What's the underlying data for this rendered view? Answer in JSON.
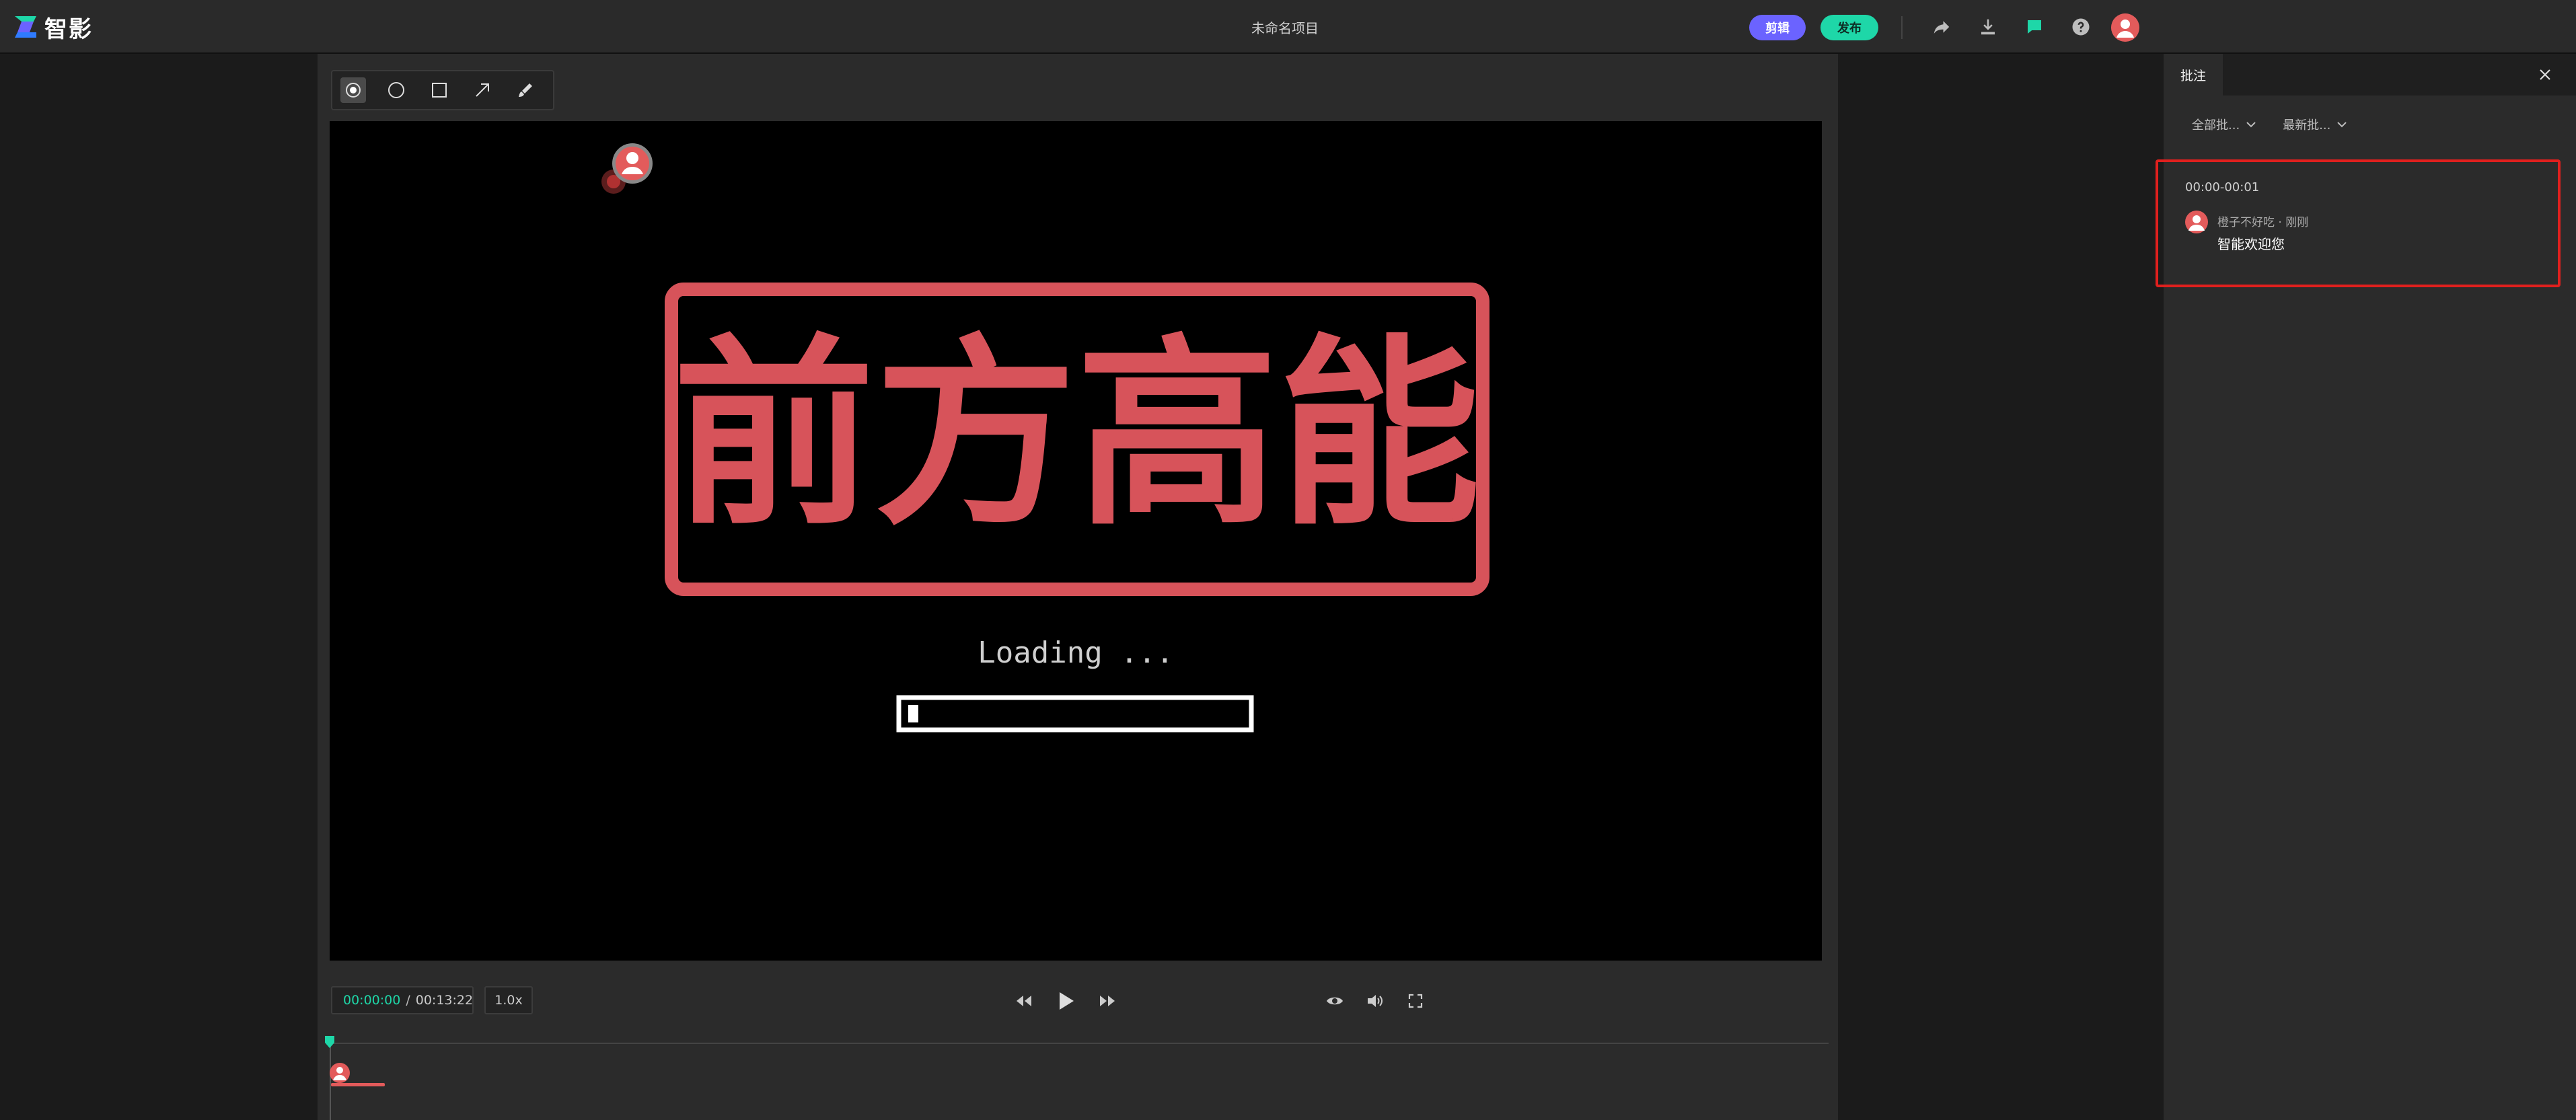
{
  "app": {
    "logo_text": "智影",
    "project_title": "未命名项目",
    "edit_label": "剪辑",
    "publish_label": "发布"
  },
  "colors": {
    "accent_green": "#1ed7a8",
    "accent_purple": "#6b63ff",
    "highlight_red": "#e0201e",
    "title_red": "#d7535a"
  },
  "video": {
    "title_text": "前方高能",
    "loading_text": "Loading ...",
    "loading_progress": 0.03
  },
  "player": {
    "current_time": "00:00:00",
    "separator": "/",
    "total_time": "00:13:22",
    "speed": "1.0x"
  },
  "panel": {
    "tab_label": "批注",
    "filter_all": "全部批...",
    "filter_sort": "最新批..."
  },
  "comment": {
    "time_range": "00:00-00:01",
    "author_meta": "橙子不好吃 · 刚刚",
    "text": "智能欢迎您"
  },
  "icons": {
    "tools": [
      "dot-tool-icon",
      "circle-tool-icon",
      "rect-tool-icon",
      "arrow-tool-icon",
      "brush-tool-icon"
    ],
    "top": [
      "share-icon",
      "download-icon",
      "comment-icon",
      "help-icon",
      "avatar"
    ]
  }
}
